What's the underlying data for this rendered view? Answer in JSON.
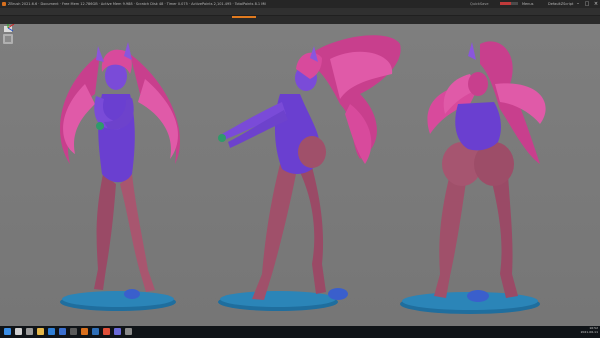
{
  "window": {
    "title": "ZBrush 2021.6.6 · Document · Free Mem 12.786GB · Active Mem 9.988 · Scratch Disk 48 · Timer 0.075 · ActivePoints 2,101.495 · TotalPoints 8.1 Mil",
    "memory_label": "QuickSave",
    "menus_label": "Menus",
    "script_label": "DefaultZScript",
    "minimize": "–",
    "maximize": "□",
    "close": "×"
  },
  "menubar": {
    "items": [
      "Alpha",
      "Brush",
      "Color",
      "Document",
      "Draw",
      "Dynamics",
      "Edit",
      "File",
      "Layer",
      "Light",
      "Macro",
      "Marker",
      "Material",
      "Movie",
      "Picker",
      "Preferences",
      "Render",
      "Stencil",
      "Stroke",
      "Texture",
      "Tool",
      "Transform",
      "Zplugin",
      "Zscript",
      "Help"
    ]
  },
  "taskbar": {
    "time": "16:52",
    "date": "2021-06-11",
    "apps": [
      "start-icon",
      "search-icon",
      "task-view-icon",
      "explorer-icon",
      "browser-icon",
      "mail-icon",
      "store-icon",
      "zbrush-icon",
      "photoshop-icon",
      "chrome-icon",
      "discord-icon",
      "app-icon"
    ]
  },
  "colors": {
    "viewport_bg": "#7a7a7a",
    "skin": "#a0506a",
    "suit": "#6a3fd0",
    "hair": "#d84a9c",
    "base": "#2a7fb0"
  }
}
